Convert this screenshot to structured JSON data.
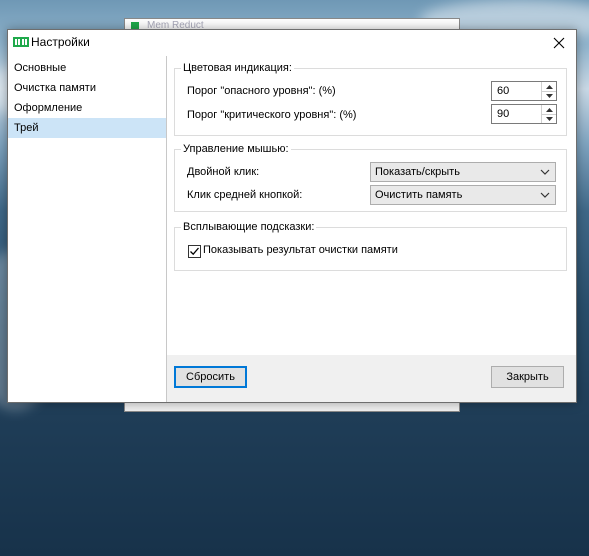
{
  "background_window": {
    "title": "Mem Reduct"
  },
  "window": {
    "title": "Настройки",
    "close_icon": "close-icon",
    "app_icon": "memreduct-icon",
    "accent": "#1fa94b"
  },
  "sidebar": {
    "items": [
      {
        "label": "Основные",
        "active": false
      },
      {
        "label": "Очистка памяти",
        "active": false
      },
      {
        "label": "Оформление",
        "active": false
      },
      {
        "label": "Трей",
        "active": true
      }
    ],
    "active_color": "#cce4f7"
  },
  "color_group": {
    "title": "Цветовая индикация:",
    "danger_label": "Порог \"опасного уровня\": (%)",
    "danger_value": "60",
    "critical_label": "Порог \"критического уровня\": (%)",
    "critical_value": "90"
  },
  "mouse_group": {
    "title": "Управление мышью:",
    "double_click_label": "Двойной клик:",
    "double_click_value": "Показать/скрыть",
    "middle_click_label": "Клик средней кнопкой:",
    "middle_click_value": "Очистить память"
  },
  "tooltip_group": {
    "title": "Всплывающие подсказки:",
    "show_result_label": "Показывать результат очистки памяти",
    "show_result_checked": true
  },
  "buttons": {
    "reset_label": "Сбросить",
    "close_label": "Закрыть"
  }
}
